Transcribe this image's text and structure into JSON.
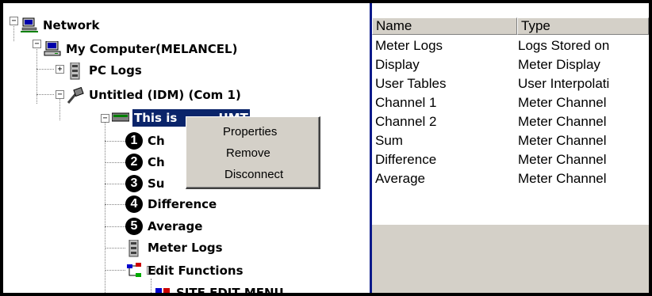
{
  "tree": {
    "items": [
      {
        "label": "Network"
      },
      {
        "label": "My Computer(MELANCEL)"
      },
      {
        "label": "PC Logs"
      },
      {
        "label": "Untitled (IDM) (Com 1)"
      },
      {
        "label": "This is",
        "suffix": "UMT"
      },
      {
        "label": "Ch"
      },
      {
        "label": "Ch"
      },
      {
        "label": "Su"
      },
      {
        "label": "Difference"
      },
      {
        "label": "Average"
      },
      {
        "label": "Meter Logs"
      },
      {
        "label": "Edit Functions"
      },
      {
        "label": "SITE EDIT MENU"
      }
    ],
    "numbers": [
      "1",
      "2",
      "3",
      "4",
      "5"
    ]
  },
  "context_menu": {
    "items": [
      "Properties",
      "Remove",
      "Disconnect"
    ]
  },
  "list": {
    "headers": [
      "Name",
      "Type"
    ],
    "rows": [
      {
        "name": "Meter Logs",
        "type": "Logs Stored on"
      },
      {
        "name": "Display",
        "type": "Meter Display"
      },
      {
        "name": "User Tables",
        "type": "User Interpolati"
      },
      {
        "name": "Channel 1",
        "type": "Meter Channel"
      },
      {
        "name": "Channel 2",
        "type": "Meter Channel"
      },
      {
        "name": "Sum",
        "type": "Meter Channel"
      },
      {
        "name": "Difference",
        "type": "Meter Channel"
      },
      {
        "name": "Average",
        "type": "Meter Channel"
      }
    ]
  }
}
